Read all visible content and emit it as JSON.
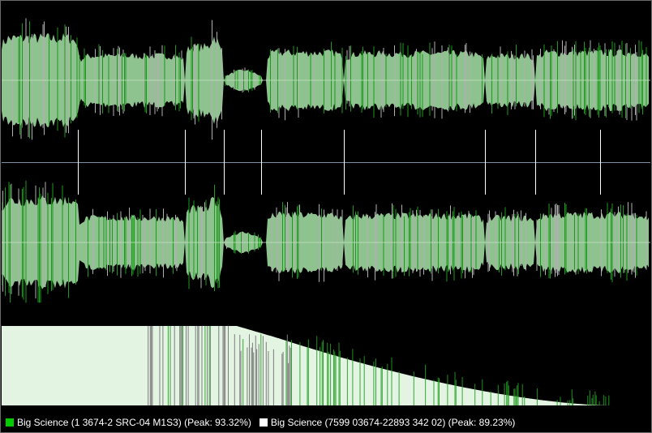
{
  "colors": {
    "background": "#000000",
    "wave_fill": "#8ec28e",
    "wave_spike_a": "#1c9a1c",
    "wave_spike_b": "#b0b0b0",
    "center_line": "#bfe3bf",
    "divider": "#7f8fa6",
    "marker": "#ffffff",
    "spectrum_fill": "#e3f4e3",
    "spectrum_spike_a": "#1fa01f",
    "spectrum_spike_b": "#7d7d7d"
  },
  "legend": {
    "items": [
      {
        "label": "Big Science (1 3674-2 SRC-04 M1S3) (Peak: 93.32%)",
        "color": "#00cc00"
      },
      {
        "label": "Big Science (7599 03674-22893 342 02) (Peak: 89.23%)",
        "color": "#ffffff"
      }
    ]
  }
}
